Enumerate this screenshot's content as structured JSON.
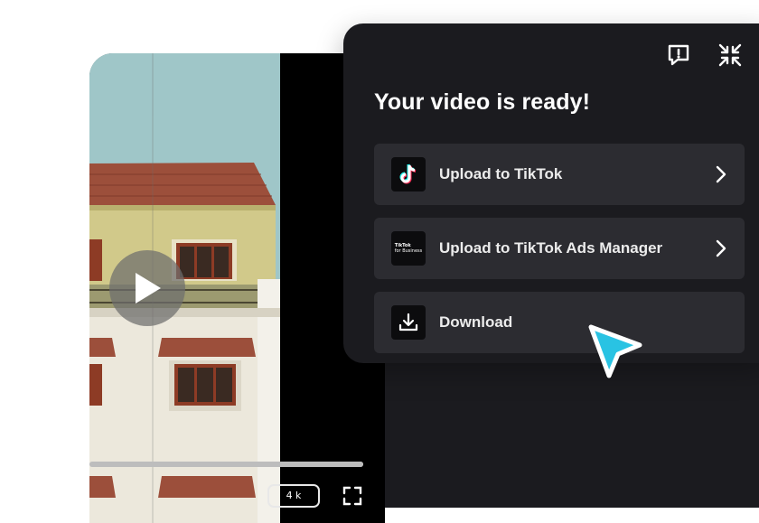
{
  "player": {
    "quality_label": "4 k",
    "progress": 1.0
  },
  "panel": {
    "title": "Your video is ready!",
    "options": [
      {
        "label": "Upload to TikTok",
        "icon": "tiktok-icon",
        "has_chevron": true
      },
      {
        "label": "Upload to TikTok Ads Manager",
        "icon": "tiktok-for-business-icon",
        "has_chevron": true
      },
      {
        "label": "Download",
        "icon": "download-icon",
        "has_chevron": false
      }
    ],
    "business_logo_text": [
      "TikTok",
      "for Business"
    ]
  },
  "colors": {
    "panel_bg": "#1b1b1f",
    "option_bg": "#2c2c31",
    "cursor": "#29c3e3",
    "tiktok_cyan": "#25f4ee",
    "tiktok_red": "#fe2c55"
  }
}
